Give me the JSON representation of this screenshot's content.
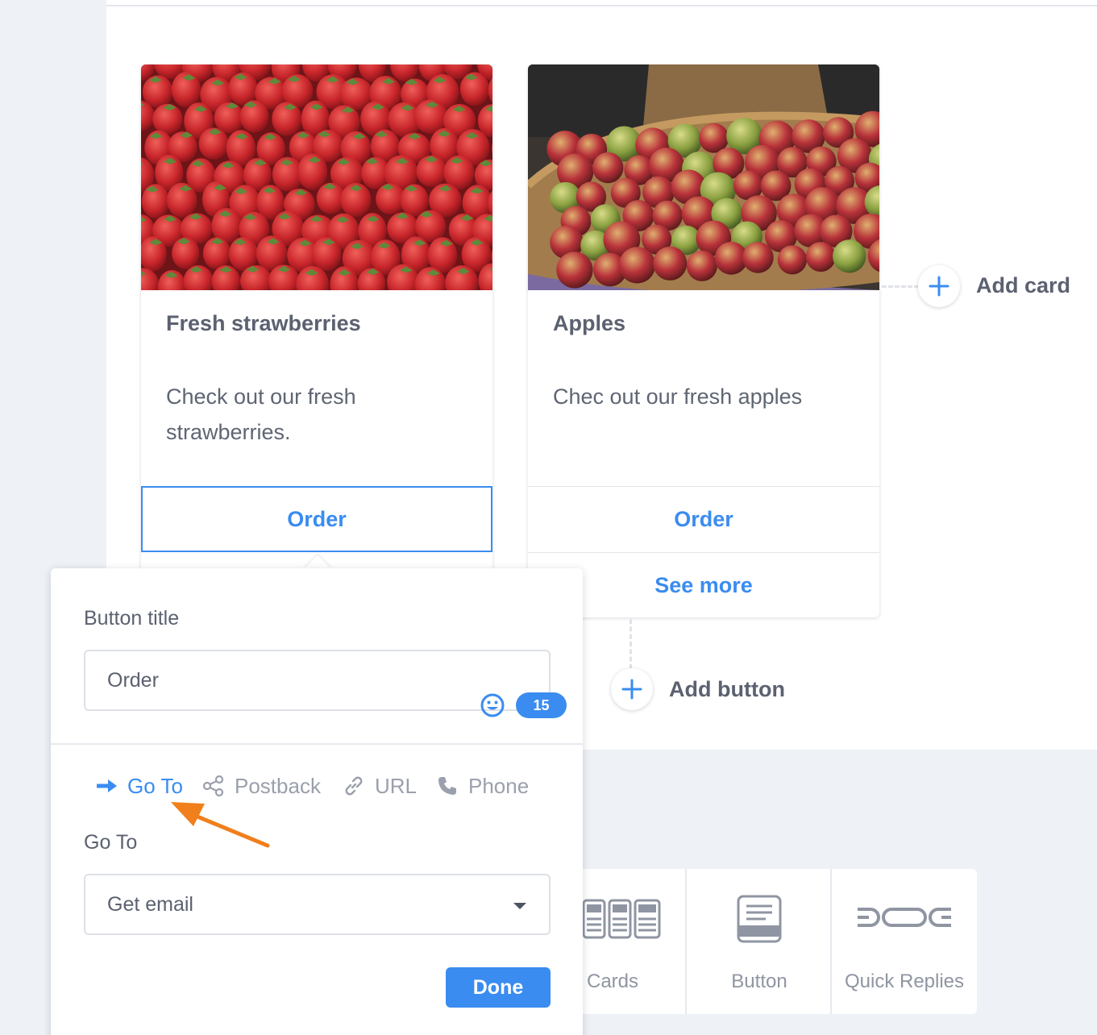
{
  "cards": [
    {
      "title": "Fresh strawberries",
      "subtitle": "Check out our fresh strawberries.",
      "image_icon": "strawberries-photo",
      "buttons": [
        "Order"
      ]
    },
    {
      "title": "Apples",
      "subtitle": "Chec out our fresh apples",
      "image_icon": "apples-photo",
      "buttons": [
        "Order",
        "See more"
      ]
    }
  ],
  "add_card_label": "Add card",
  "add_button_label": "Add button",
  "toolbar": {
    "items": [
      {
        "label": "Cards",
        "icon": "cards-icon"
      },
      {
        "label": "Button",
        "icon": "button-icon"
      },
      {
        "label": "Quick Replies",
        "icon": "quick-replies-icon"
      }
    ]
  },
  "popover": {
    "button_title_label": "Button title",
    "button_title_value": "Order",
    "char_count": "15",
    "tabs": [
      "Go To",
      "Postback",
      "URL",
      "Phone"
    ],
    "active_tab": "Go To",
    "goto_label": "Go To",
    "goto_value": "Get email",
    "done_label": "Done"
  },
  "colors": {
    "accent": "#3a8cf0",
    "annotation_arrow": "#f07f1c",
    "background": "#eef1f6"
  }
}
